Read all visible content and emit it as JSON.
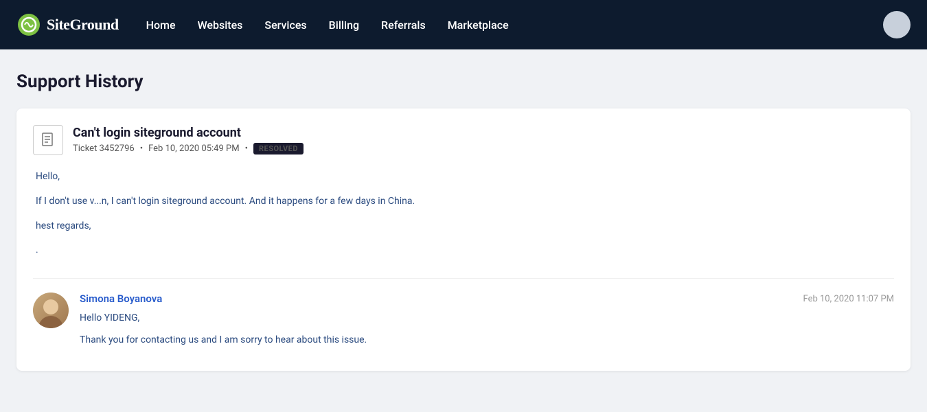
{
  "navbar": {
    "logo_text": "SiteGround",
    "nav_items": [
      {
        "label": "Home",
        "id": "home"
      },
      {
        "label": "Websites",
        "id": "websites"
      },
      {
        "label": "Services",
        "id": "services"
      },
      {
        "label": "Billing",
        "id": "billing"
      },
      {
        "label": "Referrals",
        "id": "referrals"
      },
      {
        "label": "Marketplace",
        "id": "marketplace"
      }
    ]
  },
  "page": {
    "title": "Support History"
  },
  "ticket": {
    "title": "Can't login siteground account",
    "ticket_number": "Ticket 3452796",
    "date": "Feb 10, 2020 05:49 PM",
    "status": "RESOLVED",
    "message_lines": [
      "Hello,",
      "If I don't use v...n, I can't login siteground account. And it happens for a few days in China.",
      "hest regards,",
      "."
    ]
  },
  "reply": {
    "author": "Simona Boyanova",
    "date": "Feb 10, 2020 11:07 PM",
    "lines": [
      "Hello YIDENG,",
      "Thank you for contacting us and I am sorry to hear about this issue."
    ]
  }
}
